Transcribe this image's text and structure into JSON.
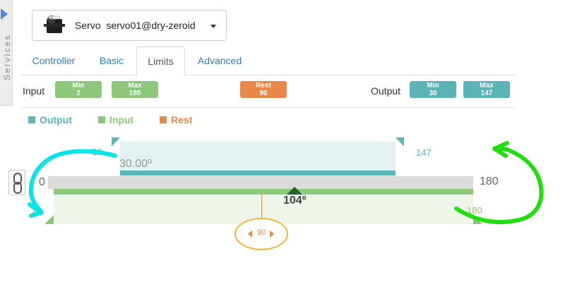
{
  "sidebar": {
    "label": "Services",
    "toggle_icon": "triangle-right-icon"
  },
  "servo_selector": {
    "label": "Servo  servo01@dry-zeroid",
    "icon": "servo-icon"
  },
  "tabs": [
    {
      "label": "Controller",
      "active": false
    },
    {
      "label": "Basic",
      "active": false
    },
    {
      "label": "Limits",
      "active": true
    },
    {
      "label": "Advanced",
      "active": false
    }
  ],
  "limits": {
    "input_label": "Input",
    "output_label": "Output",
    "input_min": {
      "label": "Min",
      "value": "2"
    },
    "input_max": {
      "label": "Max",
      "value": "180"
    },
    "rest": {
      "label": "Rest",
      "value": "90"
    },
    "output_min": {
      "label": "Min",
      "value": "30"
    },
    "output_max": {
      "label": "Max",
      "value": "147"
    }
  },
  "legend": [
    {
      "label": "Output",
      "color": "#5bb5b8"
    },
    {
      "label": "Input",
      "color": "#8cc77a"
    },
    {
      "label": "Rest",
      "color": "#e8894a"
    }
  ],
  "slider": {
    "range_min": "0",
    "range_max": "180",
    "output_min_value": "30",
    "output_min_display": "30.00º",
    "output_max_value": "147",
    "input_min_value": "2",
    "input_max_value": "180",
    "position_display": "104º",
    "rest_value": "90",
    "link_icon": "chain-link-icon"
  },
  "colors": {
    "output": "#5cb5b8",
    "input": "#8cc77a",
    "rest": "#e8894a",
    "position": "#2c5f2d",
    "annotation_cyan": "#00e5e5",
    "annotation_green": "#22dd11"
  }
}
